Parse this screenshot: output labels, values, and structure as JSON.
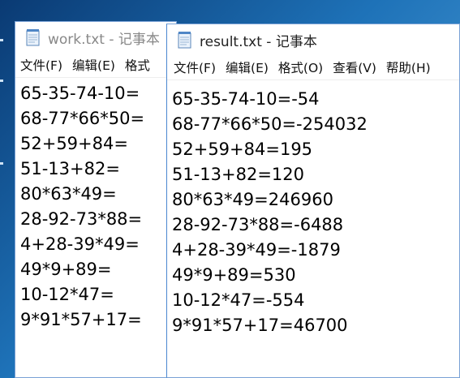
{
  "work_window": {
    "title": "work.txt - 记事本",
    "menu": [
      "文件(F)",
      "编辑(E)",
      "格式"
    ],
    "lines": [
      "65-35-74-10=",
      "68-77*66*50=",
      "52+59+84=",
      "51-13+82=",
      "80*63*49=",
      "28-92-73*88=",
      "4+28-39*49=",
      "49*9+89=",
      "10-12*47=",
      "9*91*57+17="
    ]
  },
  "result_window": {
    "title": "result.txt - 记事本",
    "menu": [
      "文件(F)",
      "编辑(E)",
      "格式(O)",
      "查看(V)",
      "帮助(H)"
    ],
    "lines": [
      "65-35-74-10=-54",
      "68-77*66*50=-254032",
      "52+59+84=195",
      "51-13+82=120",
      "80*63*49=246960",
      "28-92-73*88=-6488",
      "4+28-39*49=-1879",
      "49*9+89=530",
      "10-12*47=-554",
      "9*91*57+17=46700"
    ]
  },
  "icons": {
    "notepad": "notepad-icon"
  },
  "colors": {
    "desktop": "#1e72b8",
    "window_border": "#7aa2d6"
  }
}
